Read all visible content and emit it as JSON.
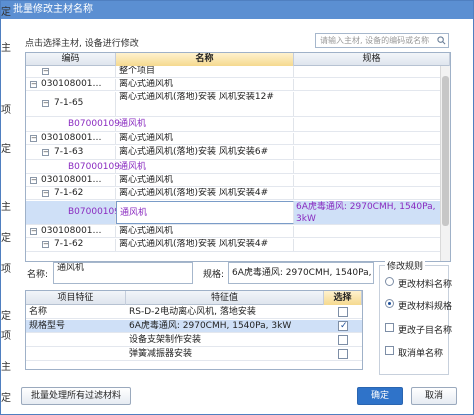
{
  "dialog": {
    "title": "批量修改主材名称"
  },
  "side_chars": [
    "定",
    "主",
    "项",
    "定",
    "主",
    "定",
    "项",
    "定",
    "项",
    "主",
    "定"
  ],
  "hint": "点击选择主材, 设备进行修改",
  "search": {
    "placeholder": "请输入主材, 设备的编码或名称"
  },
  "grid": {
    "headers": {
      "code": "编码",
      "name": "名称",
      "spec": "规格"
    },
    "rows": [
      {
        "code": "",
        "name": "整个项目",
        "spec": ""
      },
      {
        "code": "030108001…",
        "name": "离心式通风机",
        "spec": ""
      },
      {
        "code": "7-1-65",
        "name": "离心式通风机(落地)安装 风机安装12#",
        "spec": ""
      },
      {
        "code": "B07000109",
        "name": "通风机",
        "spec": ""
      },
      {
        "code": "030108001…",
        "name": "离心式通风机",
        "spec": ""
      },
      {
        "code": "7-1-63",
        "name": "离心式通风机(落地)安装 风机安装6#",
        "spec": ""
      },
      {
        "code": "B07000109",
        "name": "通风机",
        "spec": ""
      },
      {
        "code": "030108001…",
        "name": "离心式通风机",
        "spec": ""
      },
      {
        "code": "7-1-62",
        "name": "离心式通风机(落地)安装 风机安装4#",
        "spec": ""
      },
      {
        "code": "B07000109",
        "name": "通风机",
        "spec": "6A虎毒通风: 2970CMH, 1540Pa, 3kW"
      },
      {
        "code": "030108001…",
        "name": "离心式通风机",
        "spec": ""
      },
      {
        "code": "7-1-62",
        "name": "离心式通风机(落地)安装 风机安装4#",
        "spec": ""
      }
    ]
  },
  "name_field": {
    "label": "名称:",
    "value": "通风机"
  },
  "spec_field": {
    "label": "规格:",
    "value": "6A虎毒通风: 2970CMH, 1540Pa, 3kW"
  },
  "props": {
    "headers": {
      "feature": "项目特征",
      "value": "特征值",
      "select": "选择"
    },
    "rows": [
      {
        "feature": "名称",
        "value": "RS-D-2电动离心风机, 落地安装",
        "checked": false
      },
      {
        "feature": "规格型号",
        "value": "6A虎毒通风: 2970CMH, 1540Pa, 3kW",
        "checked": true
      },
      {
        "feature": "",
        "value": "设备支架制作安装",
        "checked": false
      },
      {
        "feature": "",
        "value": "弹簧减振器安装",
        "checked": false
      }
    ]
  },
  "rules": {
    "title": "修改规则",
    "options": [
      {
        "label": "更改材料名称",
        "type": "radio",
        "checked": false
      },
      {
        "label": "更改材料规格",
        "type": "radio",
        "checked": true
      },
      {
        "label": "更改子目名称",
        "type": "checkbox",
        "checked": false
      },
      {
        "label": "取消单名称",
        "type": "checkbox",
        "checked": false
      }
    ]
  },
  "buttons": {
    "batch": "批量处理所有过滤材料",
    "ok": "确定",
    "cancel": "取消"
  }
}
